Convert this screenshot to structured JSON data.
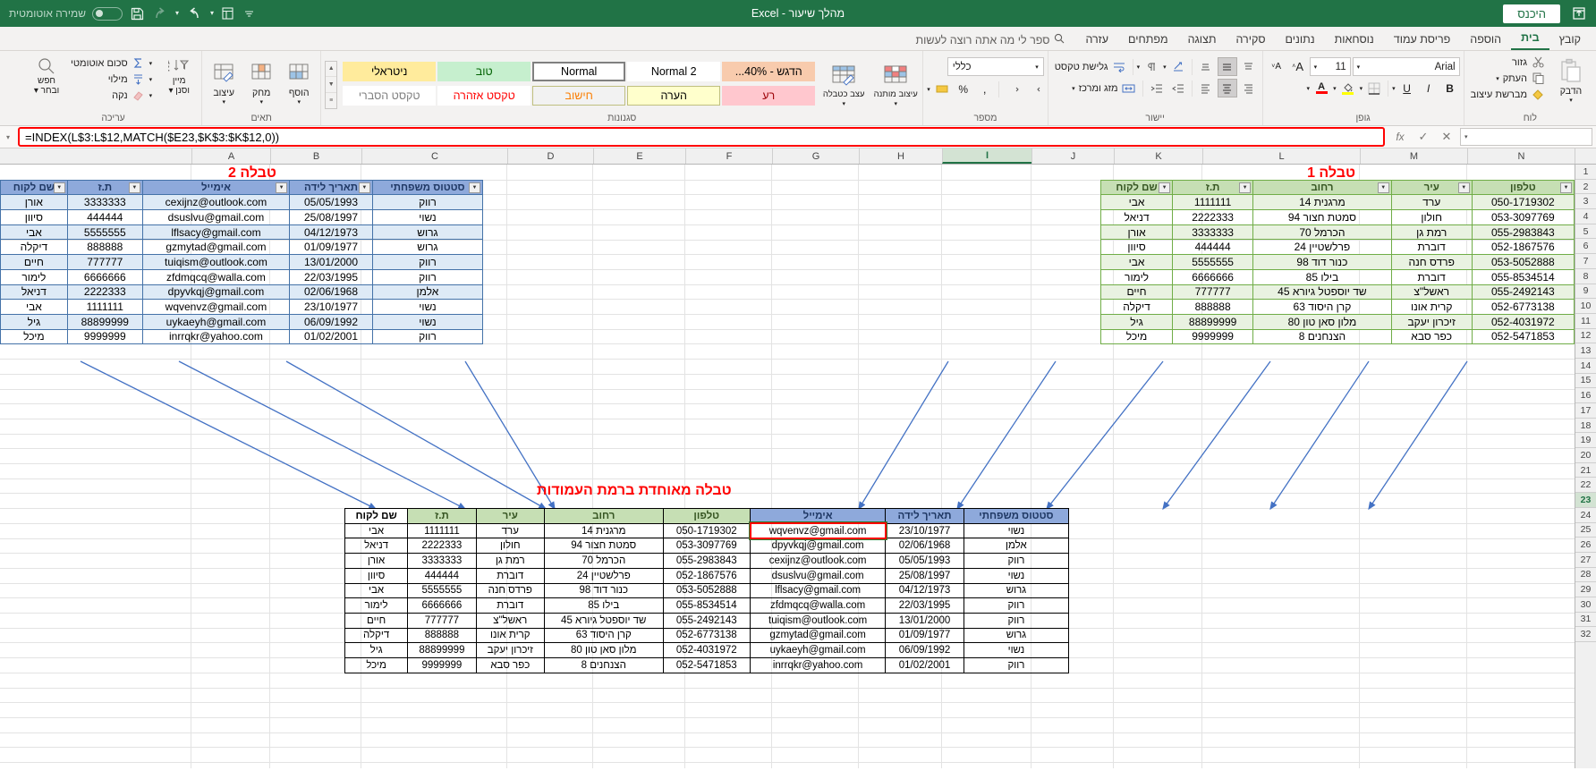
{
  "titlebar": {
    "save_icon": "save-to-cloud-icon",
    "login_label": "היכנס",
    "document_title": "מהלך שיעור - Excel",
    "autosave_label": "שמירה אוטומטית",
    "qat": [
      "save-icon",
      "redo-icon",
      "undo-icon",
      "touch-mode-icon",
      "customize-qat-icon"
    ]
  },
  "tabs": [
    {
      "label": "קובץ",
      "active": false
    },
    {
      "label": "בית",
      "active": true
    },
    {
      "label": "הוספה",
      "active": false
    },
    {
      "label": "פריסת עמוד",
      "active": false
    },
    {
      "label": "נוסחאות",
      "active": false
    },
    {
      "label": "נתונים",
      "active": false
    },
    {
      "label": "סקירה",
      "active": false
    },
    {
      "label": "תצוגה",
      "active": false
    },
    {
      "label": "מפתחים",
      "active": false
    },
    {
      "label": "עזרה",
      "active": false
    }
  ],
  "tellme": {
    "placeholder": "ספר לי מה אתה רוצה לעשות",
    "icon": "search-icon"
  },
  "ribbon": {
    "clipboard": {
      "group_label": "לוח",
      "paste": "הדבק",
      "cut": "גזור",
      "copy": "העתק",
      "format_painter": "מברשת עיצוב"
    },
    "font": {
      "group_label": "גופן",
      "font_name": "Arial",
      "font_size": "11",
      "bold": "B",
      "italic": "I",
      "underline": "U",
      "grow_font": "A",
      "shrink_font": "A",
      "borders": "borders-icon",
      "fill_color": "fill-color-icon",
      "font_color": "font-color-icon"
    },
    "alignment": {
      "group_label": "יישור",
      "wrap_text": "גלישת טקסט",
      "merge_center": "מזג ומרכז",
      "orientation": "orientation-icon",
      "rtl_text": "rtl-direction-icon"
    },
    "number": {
      "group_label": "מספר",
      "format": "כללי",
      "percent": "%",
      "comma": ",",
      "currency": "currency-icon",
      "increase_decimal": "increase-decimal-icon",
      "decrease_decimal": "decrease-decimal-icon"
    },
    "styles": {
      "group_label": "סגנונות",
      "conditional_formatting": "עיצוב מותנה",
      "format_as_table": "עיצוב כטבלה",
      "cell_styles": "עצב כטבלה",
      "gallery": [
        {
          "label": "הדגש - 40%...",
          "bg": "#f8cbad",
          "fg": "#000000",
          "border": "none"
        },
        {
          "label": "Normal 2",
          "bg": "#ffffff",
          "fg": "#000000",
          "border": "none"
        },
        {
          "label": "Normal",
          "bg": "#ffffff",
          "fg": "#000000",
          "border": "selected"
        },
        {
          "label": "טוב",
          "bg": "#c6efce",
          "fg": "#006100",
          "border": "none"
        },
        {
          "label": "ניטראלי",
          "bg": "#ffeb9c",
          "fg": "#000000",
          "border": "none"
        },
        {
          "label": "רע",
          "bg": "#ffc7ce",
          "fg": "#9c0006",
          "border": "none"
        },
        {
          "label": "הערה",
          "bg": "#ffffcc",
          "fg": "#000000",
          "border": "thin"
        },
        {
          "label": "חישוב",
          "bg": "#f2f2f2",
          "fg": "#fa7d00",
          "border": "thin"
        },
        {
          "label": "טקסט אזהרה",
          "bg": "#ffffff",
          "fg": "#ff0000",
          "border": "none"
        },
        {
          "label": "טקסט הסברי",
          "bg": "#ffffff",
          "fg": "#7f7f7f",
          "border": "none"
        }
      ]
    },
    "cells": {
      "group_label": "תאים",
      "insert": "הוסף",
      "delete": "מחק",
      "format": "עיצוב"
    },
    "editing": {
      "group_label": "עריכה",
      "autosum": "סכום אוטומטי",
      "fill": "מילוי",
      "clear": "נקה",
      "sort_filter": "מיין וסנן",
      "find_select": "חפש ובחר"
    }
  },
  "formula_bar": {
    "name_box": "",
    "cancel_icon": "cancel-icon",
    "enter_icon": "confirm-icon",
    "fx_icon": "insert-function-icon",
    "formula": "=INDEX(L$3:L$12,MATCH($E23,$K$3:$K$12,0))"
  },
  "grid": {
    "columns": [
      "N",
      "M",
      "L",
      "K",
      "J",
      "I",
      "H",
      "G",
      "F",
      "E",
      "D",
      "C",
      "B",
      "A"
    ],
    "selected_column": "I",
    "rows": [
      1,
      2,
      3,
      4,
      5,
      6,
      7,
      8,
      9,
      10,
      11,
      12,
      13,
      14,
      15,
      16,
      17,
      18,
      19,
      20,
      21,
      22,
      23,
      24,
      25,
      26,
      27,
      28,
      29,
      30,
      31,
      32
    ],
    "selected_row": 23
  },
  "table1": {
    "title": "טבלה 1",
    "headers": [
      "טלפון",
      "עיר",
      "רחוב",
      "ת.ז",
      "שם לקוח"
    ],
    "rows": [
      [
        "050-1719302",
        "ערד",
        "מרגנית 14",
        "1111111",
        "אבי"
      ],
      [
        "053-3097769",
        "חולון",
        "סמטת חצור 94",
        "2222333",
        "דניאל"
      ],
      [
        "055-2983843",
        "רמת גן",
        "הכרמל 70",
        "3333333",
        "אורן"
      ],
      [
        "052-1867576",
        "דוברת",
        "פרלשטיין 24",
        "444444",
        "סיוון"
      ],
      [
        "053-5052888",
        "פרדס חנה",
        "כנור דוד 98",
        "5555555",
        "אבי"
      ],
      [
        "055-8534514",
        "דוברת",
        "בילו 85",
        "6666666",
        "לימור"
      ],
      [
        "055-2492143",
        "ראשל\"צ",
        "שד יוספטל גיורא 45",
        "777777",
        "חיים"
      ],
      [
        "052-6773138",
        "קרית אונו",
        "קרן היסוד 63",
        "888888",
        "דיקלה"
      ],
      [
        "052-4031972",
        "זיכרון יעקב",
        "מלון סאן טון 80",
        "88899999",
        "גיל"
      ],
      [
        "052-5471853",
        "כפר סבא",
        "הצנחנים 8",
        "9999999",
        "מיכל"
      ]
    ]
  },
  "table2": {
    "title": "טבלה 2",
    "headers": [
      "סטטוס משפחתי",
      "תאריך לידה",
      "אימייל",
      "ת.ז",
      "שם לקוח"
    ],
    "rows": [
      [
        "רווק",
        "05/05/1993",
        "cexijnz@outlook.com",
        "3333333",
        "אורן"
      ],
      [
        "נשוי",
        "25/08/1997",
        "dsuslvu@gmail.com",
        "444444",
        "סיוון"
      ],
      [
        "גרוש",
        "04/12/1973",
        "lflsacy@gmail.com",
        "5555555",
        "אבי"
      ],
      [
        "גרוש",
        "01/09/1977",
        "gzmytad@gmail.com",
        "888888",
        "דיקלה"
      ],
      [
        "רווק",
        "13/01/2000",
        "tuiqism@outlook.com",
        "777777",
        "חיים"
      ],
      [
        "רווק",
        "22/03/1995",
        "zfdmqcq@walla.com",
        "6666666",
        "לימור"
      ],
      [
        "אלמן",
        "02/06/1968",
        "dpyvkqj@gmail.com",
        "2222333",
        "דניאל"
      ],
      [
        "נשוי",
        "23/10/1977",
        "wqvenvz@gmail.com",
        "1111111",
        "אבי"
      ],
      [
        "נשוי",
        "06/09/1992",
        "uykaeyh@gmail.com",
        "88899999",
        "גיל"
      ],
      [
        "רווק",
        "01/02/2001",
        "inrrqkr@yahoo.com",
        "9999999",
        "מיכל"
      ]
    ]
  },
  "merged": {
    "title": "טבלה מאוחדת ברמת העמודות",
    "headers": [
      {
        "label": "סטטוס משפחתי",
        "color": "blue"
      },
      {
        "label": "תאריך לידה",
        "color": "blue"
      },
      {
        "label": "אימייל",
        "color": "blue"
      },
      {
        "label": "טלפון",
        "color": "green"
      },
      {
        "label": "רחוב",
        "color": "green"
      },
      {
        "label": "עיר",
        "color": "green"
      },
      {
        "label": "ת.ז",
        "color": "green"
      },
      {
        "label": "שם לקוח",
        "color": "white"
      }
    ],
    "rows": [
      [
        "נשוי",
        "23/10/1977",
        "wqvenvz@gmail.com",
        "050-1719302",
        "מרגנית 14",
        "ערד",
        "1111111",
        "אבי"
      ],
      [
        "אלמן",
        "02/06/1968",
        "dpyvkqj@gmail.com",
        "053-3097769",
        "סמטת חצור 94",
        "חולון",
        "2222333",
        "דניאל"
      ],
      [
        "רווק",
        "05/05/1993",
        "cexijnz@outlook.com",
        "055-2983843",
        "הכרמל 70",
        "רמת גן",
        "3333333",
        "אורן"
      ],
      [
        "נשוי",
        "25/08/1997",
        "dsuslvu@gmail.com",
        "052-1867576",
        "פרלשטיין 24",
        "דוברת",
        "444444",
        "סיוון"
      ],
      [
        "גרוש",
        "04/12/1973",
        "lflsacy@gmail.com",
        "053-5052888",
        "כנור דוד 98",
        "פרדס חנה",
        "5555555",
        "אבי"
      ],
      [
        "רווק",
        "22/03/1995",
        "zfdmqcq@walla.com",
        "055-8534514",
        "בילו 85",
        "דוברת",
        "6666666",
        "לימור"
      ],
      [
        "רווק",
        "13/01/2000",
        "tuiqism@outlook.com",
        "055-2492143",
        "שד יוספטל גיורא 45",
        "ראשל\"צ",
        "777777",
        "חיים"
      ],
      [
        "גרוש",
        "01/09/1977",
        "gzmytad@gmail.com",
        "052-6773138",
        "קרן היסוד 63",
        "קרית אונו",
        "888888",
        "דיקלה"
      ],
      [
        "נשוי",
        "06/09/1992",
        "uykaeyh@gmail.com",
        "052-4031972",
        "מלון סאן טון 80",
        "זיכרון יעקב",
        "88899999",
        "גיל"
      ],
      [
        "רווק",
        "01/02/2001",
        "inrrqkr@yahoo.com",
        "052-5471853",
        "הצנחנים 8",
        "כפר סבא",
        "9999999",
        "מיכל"
      ]
    ],
    "selected_cell_value": "wqvenvz@gmail.com"
  },
  "colors": {
    "brand_green": "#217346",
    "table1_header": "#c6dfb4",
    "table2_header": "#8ea9db",
    "title_red": "#ff0000",
    "arrow_blue": "#4472c4"
  }
}
